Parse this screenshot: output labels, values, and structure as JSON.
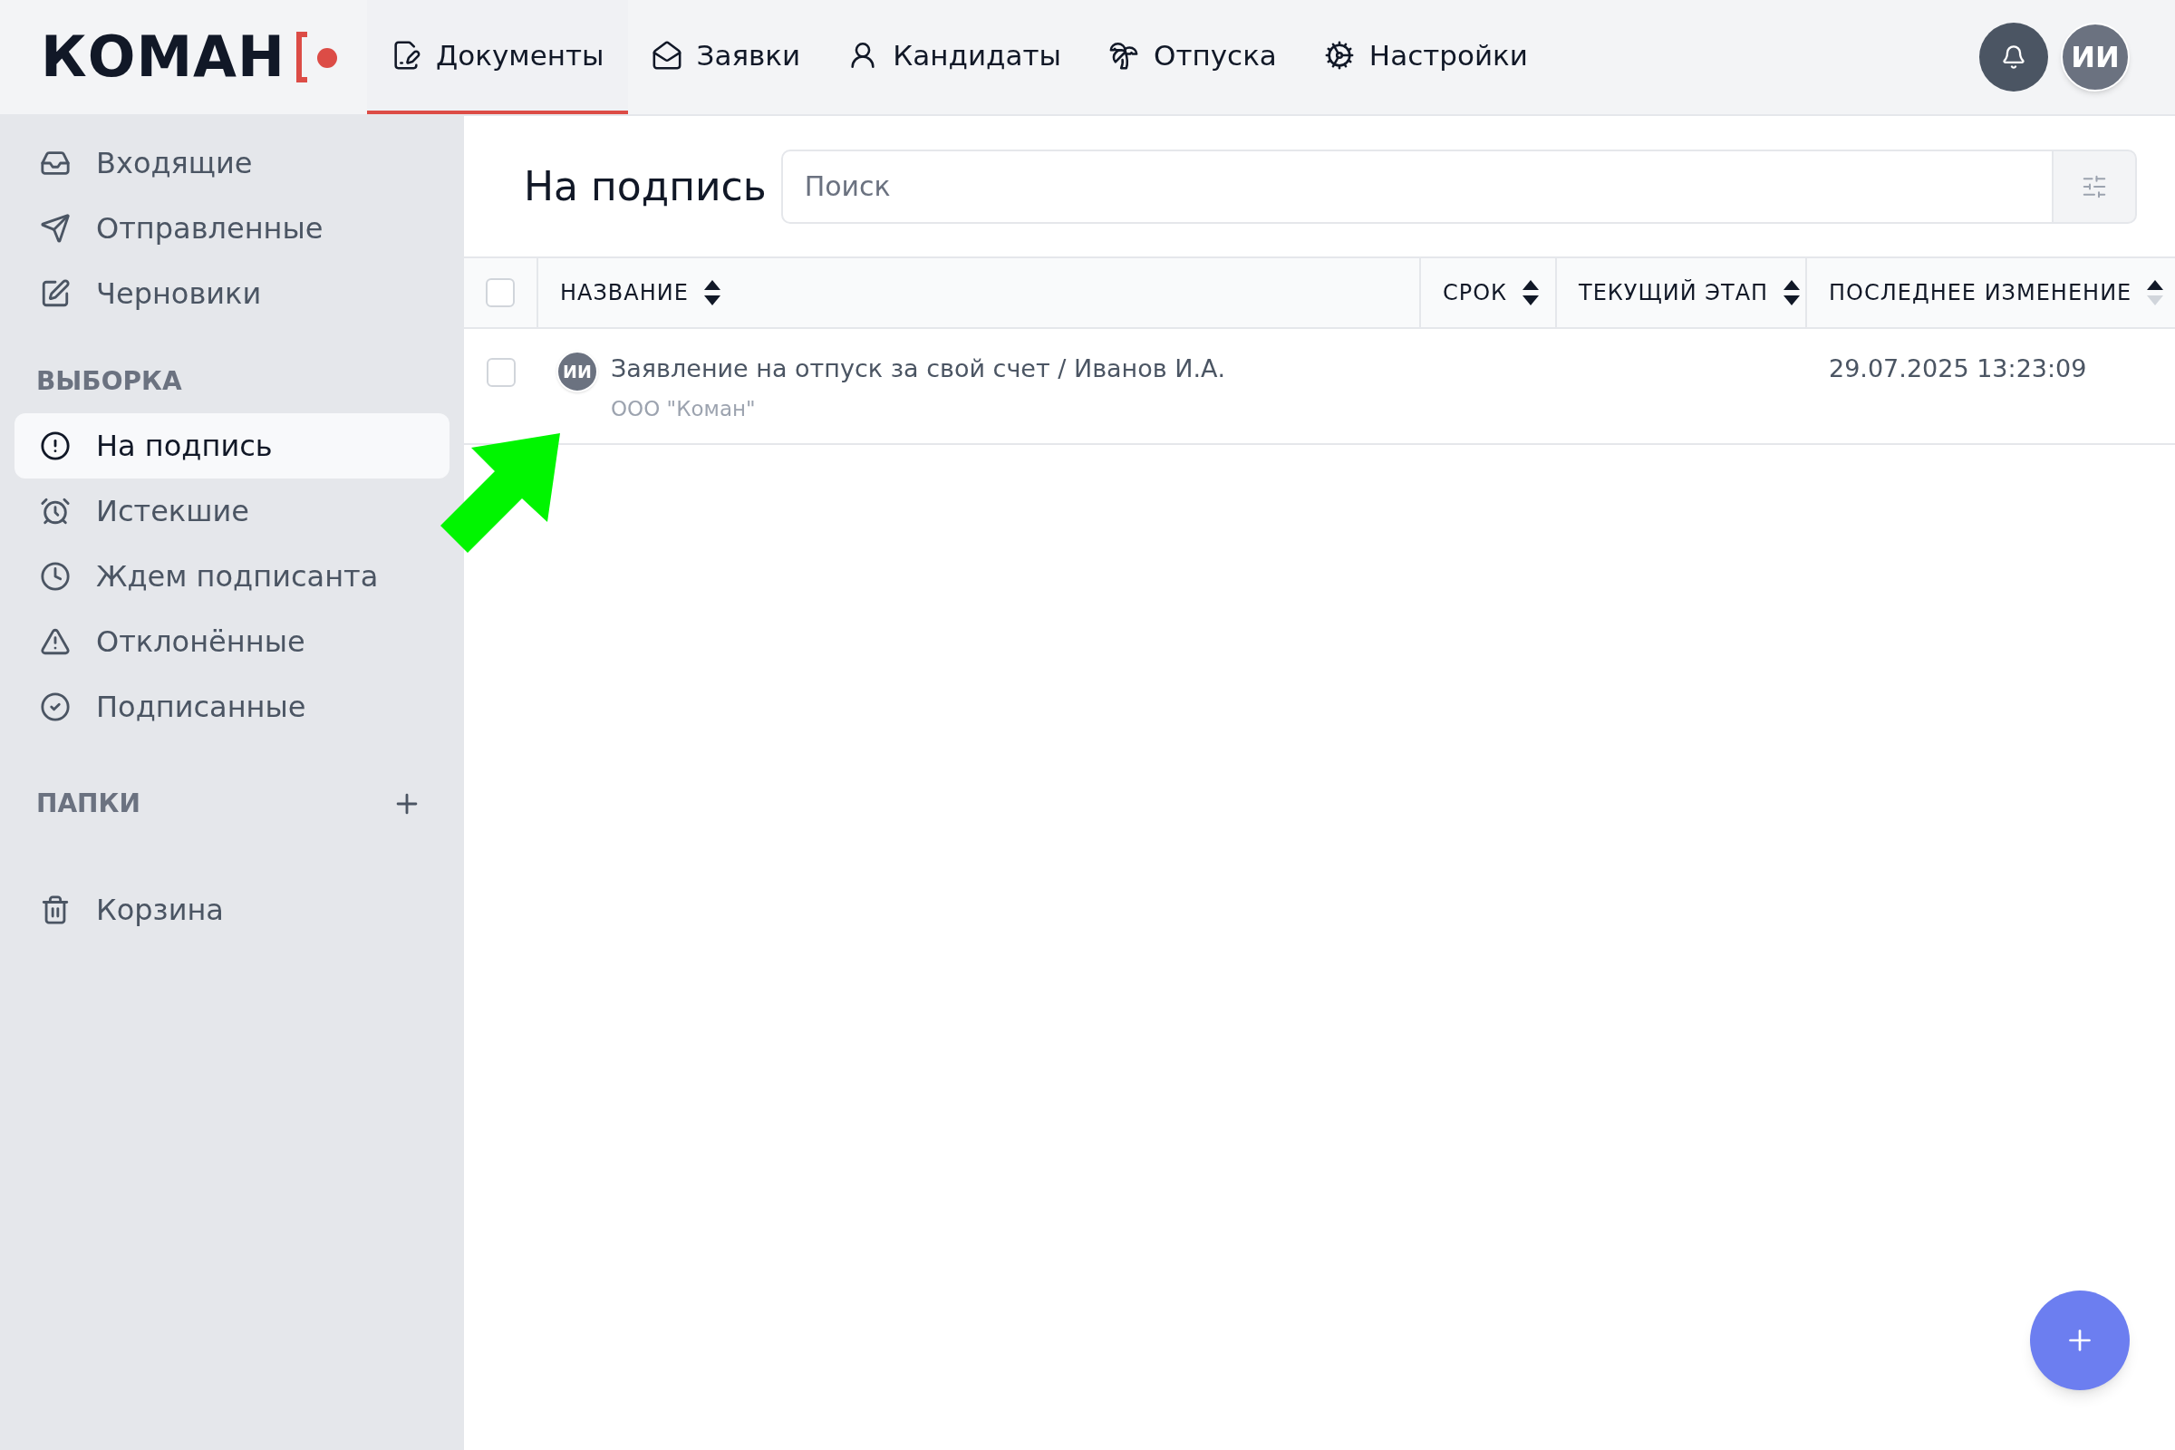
{
  "logo": {
    "text": "КОМАН"
  },
  "nav": [
    {
      "label": "Документы",
      "selected": true
    },
    {
      "label": "Заявки",
      "selected": false
    },
    {
      "label": "Кандидаты",
      "selected": false
    },
    {
      "label": "Отпуска",
      "selected": false
    },
    {
      "label": "Настройки",
      "selected": false
    }
  ],
  "user": {
    "initials": "ИИ"
  },
  "sidebar": {
    "mailboxes": [
      {
        "label": "Входящие",
        "selected": false
      },
      {
        "label": "Отправленные",
        "selected": false
      },
      {
        "label": "Черновики",
        "selected": false
      }
    ],
    "filters": {
      "title": "ВЫБОРКА",
      "items": [
        {
          "label": "На подпись",
          "selected": true
        },
        {
          "label": "Истекшие",
          "selected": false
        },
        {
          "label": "Ждем подписанта",
          "selected": false
        },
        {
          "label": "Отклонённые",
          "selected": false
        },
        {
          "label": "Подписанные",
          "selected": false
        }
      ]
    },
    "folders": {
      "title": "ПАПКИ"
    },
    "trash": {
      "label": "Корзина",
      "selected": false
    }
  },
  "page": {
    "title": "На подпись",
    "search": {
      "placeholder": "Поиск"
    }
  },
  "table": {
    "all_checked": false,
    "columns": [
      {
        "label": "НАЗВАНИЕ",
        "sorted": false
      },
      {
        "label": "СРОК",
        "sorted": false
      },
      {
        "label": "ТЕКУЩИЙ ЭТАП",
        "sorted": false
      },
      {
        "label": "ПОСЛЕДНЕЕ ИЗМЕНЕНИЕ",
        "sorted": true
      }
    ],
    "rows": [
      {
        "checked": false,
        "avatar": "ИИ",
        "title": "Заявление на отпуск за свой счет / Иванов И.А.",
        "org": "ООО \"Коман\"",
        "last_modified": "29.07.2025 13:23:09"
      }
    ]
  }
}
